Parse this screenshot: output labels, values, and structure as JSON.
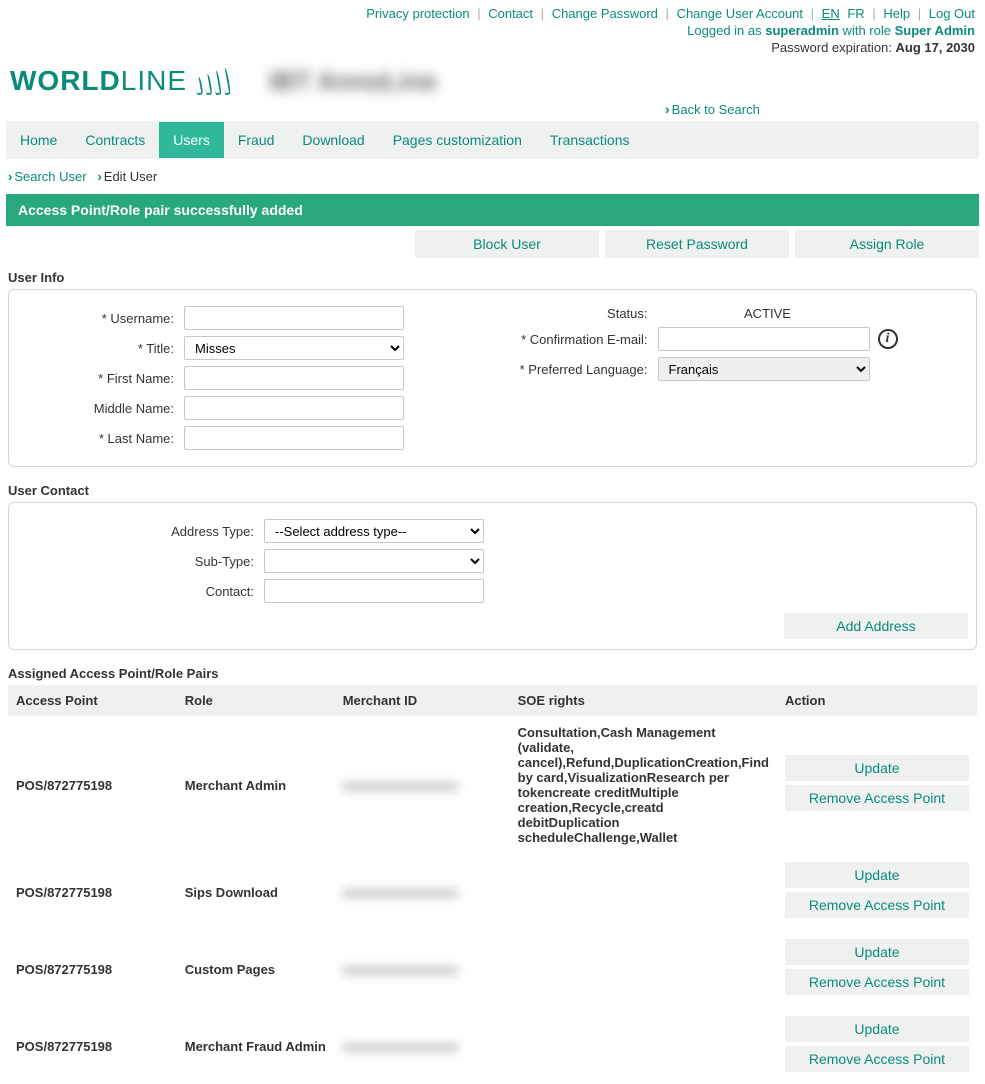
{
  "topLinks": {
    "privacy": "Privacy protection",
    "contact": "Contact",
    "changePassword": "Change Password",
    "changeUserAccount": "Change User Account",
    "langEN": "EN",
    "langFR": "FR",
    "help": "Help",
    "logout": "Log Out"
  },
  "loginLine": {
    "prefix": "Logged in as ",
    "username": "superadmin",
    "withRole": " with role ",
    "role": "Super Admin",
    "pwdExpPrefix": "Password expiration: ",
    "pwdExpDate": "Aug 17, 2030"
  },
  "logo": {
    "part1": "WORLD",
    "part2": "LINE"
  },
  "accountNameBlur": "IBT AnnoLine",
  "backToSearch": "Back to Search",
  "tabs": {
    "home": "Home",
    "contracts": "Contracts",
    "users": "Users",
    "fraud": "Fraud",
    "download": "Download",
    "pages": "Pages customization",
    "transactions": "Transactions"
  },
  "breadcrumb": {
    "searchUser": "Search User",
    "editUser": "Edit User"
  },
  "successBanner": "Access Point/Role pair successfully added",
  "mainButtons": {
    "block": "Block User",
    "reset": "Reset Password",
    "assign": "Assign Role"
  },
  "sections": {
    "userInfo": "User Info",
    "userContact": "User Contact",
    "assigned": "Assigned Access Point/Role Pairs"
  },
  "userInfo": {
    "usernameLabel": "* Username:",
    "usernameValue": "",
    "titleLabel": "* Title:",
    "titleValue": "Misses",
    "firstNameLabel": "* First Name:",
    "firstNameValue": "",
    "middleNameLabel": "Middle Name:",
    "middleNameValue": "",
    "lastNameLabel": "* Last Name:",
    "lastNameValue": "",
    "statusLabel": "Status:",
    "statusValue": "ACTIVE",
    "confirmEmailLabel": "* Confirmation E-mail:",
    "confirmEmailValue": "",
    "prefLangLabel": "* Preferred Language:",
    "prefLangValue": "Français"
  },
  "userContact": {
    "addressTypeLabel": "Address Type:",
    "addressTypeValue": "--Select address type--",
    "subTypeLabel": "Sub-Type:",
    "subTypeValue": "",
    "contactLabel": "Contact:",
    "contactValue": "",
    "addAddress": "Add Address"
  },
  "tableHeaders": {
    "accessPoint": "Access Point",
    "role": "Role",
    "merchantId": "Merchant ID",
    "soeRights": "SOE rights",
    "action": "Action"
  },
  "tableActions": {
    "update": "Update",
    "remove": "Remove Access Point"
  },
  "rows": [
    {
      "accessPoint": "POS/872775198",
      "role": "Merchant Admin",
      "merchantId": "xxxxxxxxxxxxxxxx",
      "rights": "Consultation,Cash Management (validate, cancel),Refund,DuplicationCreation,Find by card,VisualizationResearch per tokencreate creditMultiple creation,Recycle,creatd debitDuplication scheduleChallenge,Wallet"
    },
    {
      "accessPoint": "POS/872775198",
      "role": "Sips Download",
      "merchantId": "xxxxxxxxxxxxxxxx",
      "rights": ""
    },
    {
      "accessPoint": "POS/872775198",
      "role": "Custom Pages",
      "merchantId": "xxxxxxxxxxxxxxxx",
      "rights": ""
    },
    {
      "accessPoint": "POS/872775198",
      "role": "Merchant Fraud Admin",
      "merchantId": "xxxxxxxxxxxxxxxx",
      "rights": ""
    }
  ]
}
